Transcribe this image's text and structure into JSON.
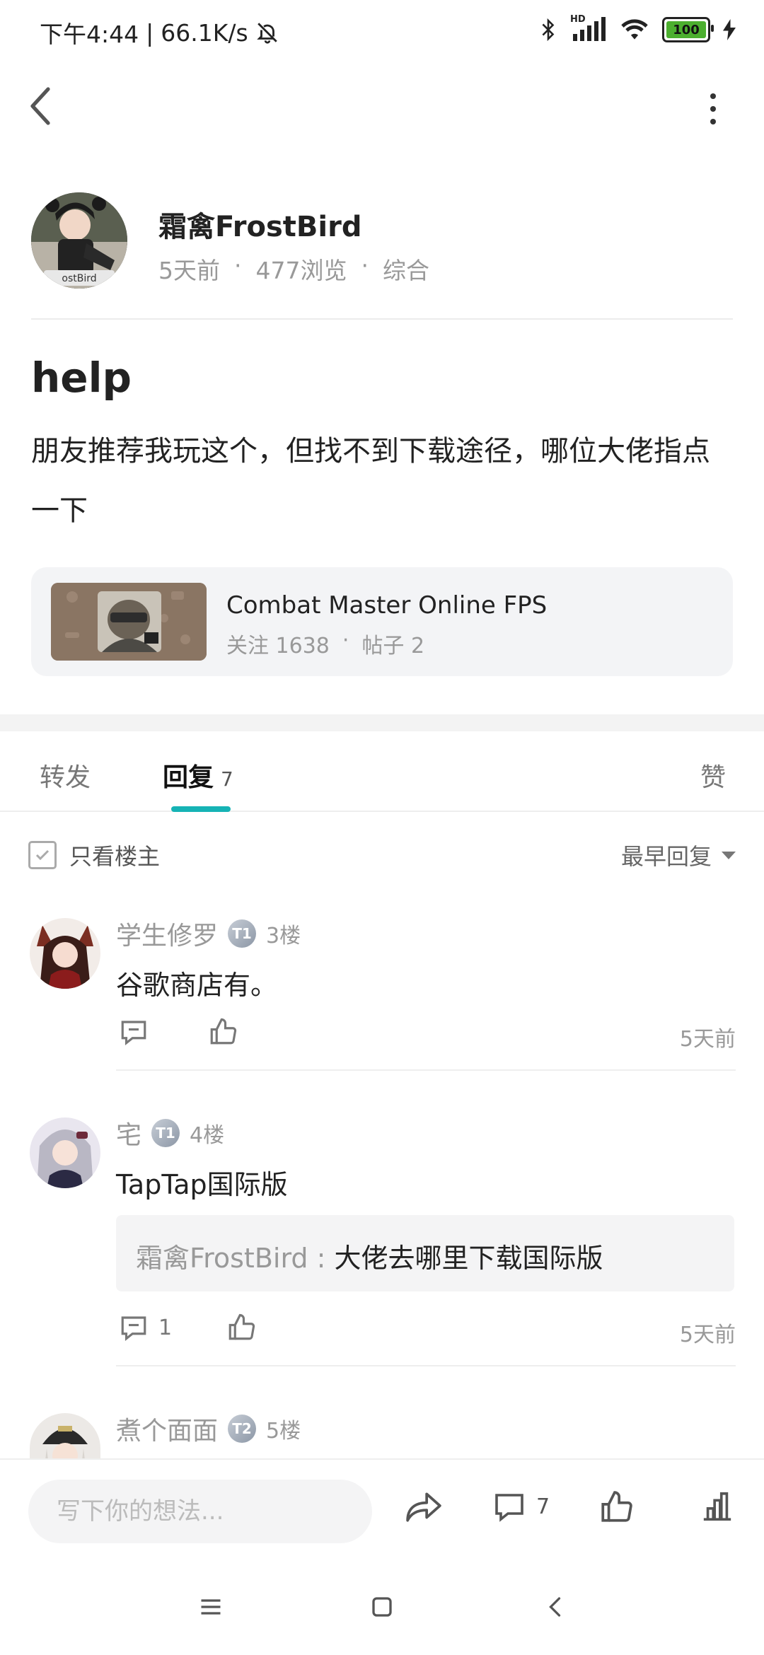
{
  "status_bar": {
    "time": "下午4:44",
    "net_speed": "66.1K/s",
    "hd_label": "HD",
    "battery": "100"
  },
  "post": {
    "author": "霜禽FrostBird",
    "time": "5天前",
    "views": "477浏览",
    "category": "综合",
    "sep": "·",
    "title": "help",
    "body": "朋友推荐我玩这个，但找不到下载途径，哪位大佬指点一下"
  },
  "game_card": {
    "name": "Combat Master Online FPS",
    "follow_label": "关注 1638",
    "posts_label": "帖子 2",
    "sep": "·"
  },
  "tabs": {
    "repost": "转发",
    "reply": "回复",
    "reply_count": "7",
    "like": "赞"
  },
  "filter": {
    "only_op": "只看楼主",
    "sort": "最早回复"
  },
  "comments": [
    {
      "name": "学生修罗",
      "badge": "T1",
      "floor": "3楼",
      "text": "谷歌商店有。",
      "reply_count": "",
      "time": "5天前"
    },
    {
      "name": "宅",
      "badge": "T1",
      "floor": "4楼",
      "text": "TapTap国际版",
      "quote_author": "霜禽FrostBird",
      "quote_sep": ":",
      "quote_text": "大佬去哪里下载国际版",
      "reply_count": "1",
      "time": "5天前"
    },
    {
      "name": "煮个面面",
      "badge": "T2",
      "floor": "5楼"
    }
  ],
  "bottom_bar": {
    "input_placeholder": "写下你的想法...",
    "comment_count": "7"
  },
  "colors": {
    "accent": "#16b3b5",
    "battery_fill": "#4caf2f"
  }
}
